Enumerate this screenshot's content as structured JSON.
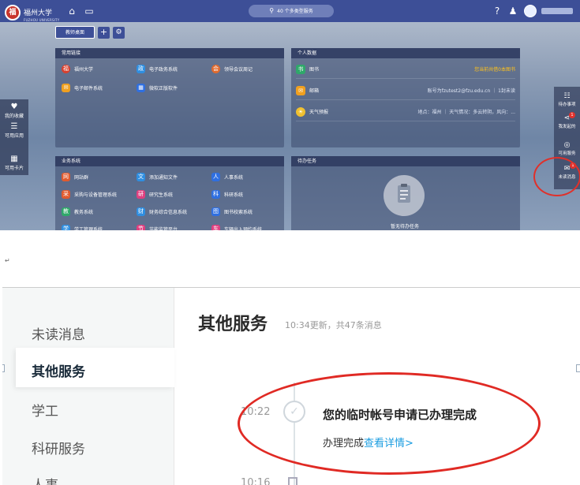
{
  "portal": {
    "logo_seal": "福",
    "logo_text": "福州大学",
    "logo_sub": "FUZHOU UNIVERSITY",
    "search_text": "40 个多类型服务",
    "home_tab": "教师桌面",
    "add_label": "+",
    "settings_glyph": "⚙",
    "left_dock": [
      {
        "label": "我的收藏",
        "icon": "heart-icon",
        "glyph": "♥"
      },
      {
        "label": "可用应用",
        "icon": "list-icon",
        "glyph": "☰"
      },
      {
        "label": "可用卡片",
        "icon": "grid-icon",
        "glyph": "▦"
      }
    ],
    "common_links": {
      "title": "常用链接",
      "items": [
        {
          "label": "福州大学",
          "color": "#d8402e",
          "glyph": "福"
        },
        {
          "label": "电子政务系统",
          "color": "#2f8ee0",
          "glyph": "政"
        },
        {
          "label": "领导会议周记",
          "color": "#e06a2e",
          "glyph": "会"
        },
        {
          "label": "电子邮件系统",
          "color": "#f0a020",
          "glyph": "✉"
        },
        {
          "label": "微软正版软件",
          "color": "#2f6fe0",
          "glyph": "▦"
        }
      ]
    },
    "personal": {
      "title": "个人数据",
      "rows": [
        {
          "label": "图书",
          "right": "您当前共借0本图书",
          "right_hl": true,
          "color": "#2fa86a",
          "glyph": "书"
        },
        {
          "label": "邮箱",
          "right": "账号为fzutest2@fzu.edu.cn ｜ 1封未读",
          "right_hl": false,
          "color": "#f0a020",
          "glyph": "✉"
        },
        {
          "label": "天气预报",
          "right": "地点：福州 ｜ 天气情况：多云转阴，风向：...",
          "right_hl": false,
          "color": "#f0c030",
          "glyph": "☀"
        }
      ]
    },
    "business": {
      "title": "业务系统",
      "items": [
        {
          "label": "网站群",
          "color": "#e05a2e",
          "glyph": "网"
        },
        {
          "label": "添加通知文件",
          "color": "#2f8ee0",
          "glyph": "文"
        },
        {
          "label": "人事系统",
          "color": "#2f6fe0",
          "glyph": "人"
        },
        {
          "label": "采购与设备管理系统",
          "color": "#e05a2e",
          "glyph": "采"
        },
        {
          "label": "研究生系统",
          "color": "#e04080",
          "glyph": "研"
        },
        {
          "label": "科研系统",
          "color": "#2f6fe0",
          "glyph": "科"
        },
        {
          "label": "教务系统",
          "color": "#2fa86a",
          "glyph": "教"
        },
        {
          "label": "财务综合信息系统",
          "color": "#2f8ee0",
          "glyph": "财"
        },
        {
          "label": "图书校索系统",
          "color": "#2f6fe0",
          "glyph": "图"
        },
        {
          "label": "学工管理系统",
          "color": "#2f8ee0",
          "glyph": "学"
        },
        {
          "label": "节能监管平台",
          "color": "#e04080",
          "glyph": "节"
        },
        {
          "label": "车辆出入预约系统",
          "color": "#e04080",
          "glyph": "车"
        }
      ]
    },
    "todo": {
      "title": "待办任务",
      "empty": "暂无待办任务"
    },
    "right_dock": [
      {
        "label": "待办事项",
        "icon": "sliders-icon",
        "glyph": "☷",
        "badge": ""
      },
      {
        "label": "我发起的",
        "icon": "share-icon",
        "glyph": "⋖",
        "badge": "1"
      },
      {
        "label": "可用服务",
        "icon": "shield-icon",
        "glyph": "◎",
        "badge": ""
      },
      {
        "label": "未读消息",
        "icon": "chat-icon",
        "glyph": "✉",
        "badge": "1"
      }
    ]
  },
  "return_mark": "↵",
  "messages": {
    "nav": [
      "未读消息",
      "其他服务",
      "学工",
      "科研服务",
      "人事"
    ],
    "active_index": 1,
    "title": "其他服务",
    "subtitle": "10:34更新，共47条消息",
    "item_time": "10:22",
    "item_title": "您的临时帐号申请已办理完成",
    "item_desc": "办理完成",
    "item_link": "查看详情>",
    "item2_time": "10:16"
  }
}
